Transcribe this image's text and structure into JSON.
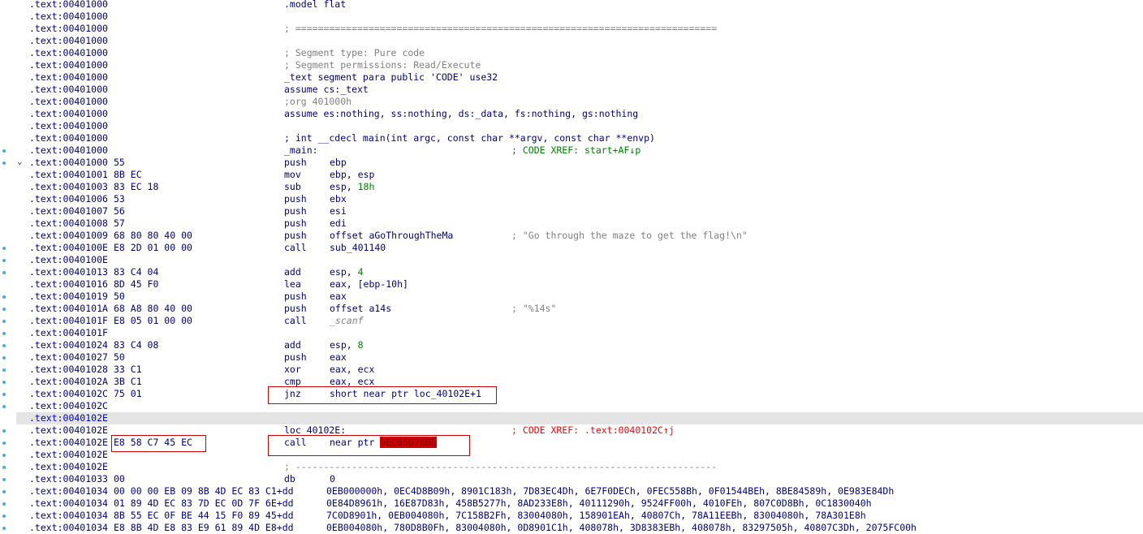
{
  "lines": [
    {
      "addr": ".text:00401000",
      "text": ".model flat",
      "text_class": ""
    },
    {
      "addr": ".text:00401000"
    },
    {
      "addr": ".text:00401000",
      "text": "; ===========================================================================",
      "text_class": "gray"
    },
    {
      "addr": ".text:00401000"
    },
    {
      "addr": ".text:00401000",
      "text": "; Segment type: Pure code",
      "text_class": "gray"
    },
    {
      "addr": ".text:00401000",
      "text": "; Segment permissions: Read/Execute",
      "text_class": "gray"
    },
    {
      "addr": ".text:00401000",
      "text": "_text segment para public 'CODE' use32",
      "text_class": ""
    },
    {
      "addr": ".text:00401000",
      "text": "assume cs:_text",
      "text_class": ""
    },
    {
      "addr": ".text:00401000",
      "text": ";org 401000h",
      "text_class": "gray"
    },
    {
      "addr": ".text:00401000",
      "text": "assume es:nothing, ss:nothing, ds:_data, fs:nothing, gs:nothing",
      "text_class": ""
    },
    {
      "addr": ".text:00401000"
    },
    {
      "addr": ".text:00401000",
      "text": "; int __cdecl main(int argc, const char **argv, const char **envp)",
      "text_class": ""
    },
    {
      "addr": ".text:00401000",
      "text": "_main:",
      "text_class": "",
      "comment": "; CODE XREF: start+AF↓p",
      "comment_class": "green"
    },
    {
      "addr": ".text:00401000",
      "bytes": "55",
      "mn": "push",
      "op": "ebp"
    },
    {
      "addr": ".text:00401001",
      "bytes": "8B EC",
      "mn": "mov",
      "op": "ebp, esp"
    },
    {
      "addr": ".text:00401003",
      "bytes": "83 EC 18",
      "mn": "sub",
      "op": "esp, ",
      "op_num": "18h"
    },
    {
      "addr": ".text:00401006",
      "bytes": "53",
      "mn": "push",
      "op": "ebx"
    },
    {
      "addr": ".text:00401007",
      "bytes": "56",
      "mn": "push",
      "op": "esi"
    },
    {
      "addr": ".text:00401008",
      "bytes": "57",
      "mn": "push",
      "op": "edi"
    },
    {
      "addr": ".text:00401009",
      "bytes": "68 80 80 40 00",
      "mn": "push",
      "op": "offset aGoThroughTheMa",
      "comment": "; \"Go through the maze to get the flag!\\n\"",
      "comment_class": "gray"
    },
    {
      "addr": ".text:0040100E",
      "bytes": "E8 2D 01 00 00",
      "mn": "call",
      "op": "sub_401140"
    },
    {
      "addr": ".text:0040100E"
    },
    {
      "addr": ".text:00401013",
      "bytes": "83 C4 04",
      "mn": "add",
      "op": "esp, ",
      "op_num": "4"
    },
    {
      "addr": ".text:00401016",
      "bytes": "8D 45 F0",
      "mn": "lea",
      "op": "eax, [ebp-10h]"
    },
    {
      "addr": ".text:00401019",
      "bytes": "50",
      "mn": "push",
      "op": "eax"
    },
    {
      "addr": ".text:0040101A",
      "bytes": "68 A8 80 40 00",
      "mn": "push",
      "op": "offset a14s",
      "comment": "; \"%14s\"",
      "comment_class": "gray"
    },
    {
      "addr": ".text:0040101F",
      "bytes": "E8 05 01 00 00",
      "mn": "call",
      "op_ital": "_scanf"
    },
    {
      "addr": ".text:0040101F"
    },
    {
      "addr": ".text:00401024",
      "bytes": "83 C4 08",
      "mn": "add",
      "op": "esp, ",
      "op_num": "8"
    },
    {
      "addr": ".text:00401027",
      "bytes": "50",
      "mn": "push",
      "op": "eax"
    },
    {
      "addr": ".text:00401028",
      "bytes": "33 C1",
      "mn": "xor",
      "op": "eax, ecx"
    },
    {
      "addr": ".text:0040102A",
      "bytes": "3B C1",
      "mn": "cmp",
      "op": "eax, ecx"
    },
    {
      "addr": ".text:0040102C",
      "bytes": "75 01",
      "mn": "jnz",
      "op": "short near ptr loc_40102E+1"
    },
    {
      "addr": ".text:0040102C"
    },
    {
      "addr": ".text:0040102E",
      "highlight": true
    },
    {
      "addr": ".text:0040102E",
      "text": "loc_40102E:",
      "text_class": "",
      "comment": "; CODE XREF: .text:0040102C↑j",
      "comment_class": "red"
    },
    {
      "addr": ".text:0040102E",
      "bytes": "E8 58 C7 45 EC",
      "mn": "call",
      "op": "near ptr ",
      "op_red": "0EC85D78Bh"
    },
    {
      "addr": ".text:0040102E"
    },
    {
      "addr": ".text:0040102E",
      "text": "; ---------------------------------------------------------------------------",
      "text_class": "gray"
    },
    {
      "addr": ".text:00401033",
      "bytes": "00",
      "mn": "db",
      "op": "0"
    },
    {
      "addr": ".text:00401034",
      "bytes": "00 00 00 EB 09 8B 4D EC 83 C1+dd",
      "op_dd": "0EB000000h, 0EC4D8B09h, 8901C183h, 7D83EC4Dh, 6E7F0DECh, 0FEC558Bh, 0F01544BEh, 8BE84589h, 0E983E84Dh"
    },
    {
      "addr": ".text:00401034",
      "bytes": "01 89 4D EC 83 7D EC 0D 7F 6E+dd",
      "op_dd": "0E84D8961h, 16E87D83h, 458B5277h, 8AD233E8h, 40111290h, 9524FF00h, 4010FEh, 807C0D8Bh, 0C1830040h"
    },
    {
      "addr": ".text:00401034",
      "bytes": "8B 55 EC 0F BE 44 15 F0 89 45+dd",
      "op_dd": "7C0D8901h, 0EB004080h, 7C158B2Fh, 83004080h, 158901EAh, 40807Ch, 78A11EEBh, 83004080h, 78A301E8h"
    },
    {
      "addr": ".text:00401034",
      "bytes": "E8 8B 4D E8 83 E9 61 89 4D E8+dd",
      "op_dd": "0EB004080h, 780D8B0Fh, 83004080h, 0D8901C1h, 408078h, 3D8383EBh, 408078h, 83297505h, 40807C3Dh, 2075FC00h"
    }
  ],
  "dot_rows": [
    12,
    13,
    20,
    21,
    22,
    24,
    25,
    26,
    27,
    28,
    29,
    30,
    31,
    32,
    33,
    35,
    36,
    37,
    38,
    39,
    40,
    41,
    42,
    43
  ]
}
